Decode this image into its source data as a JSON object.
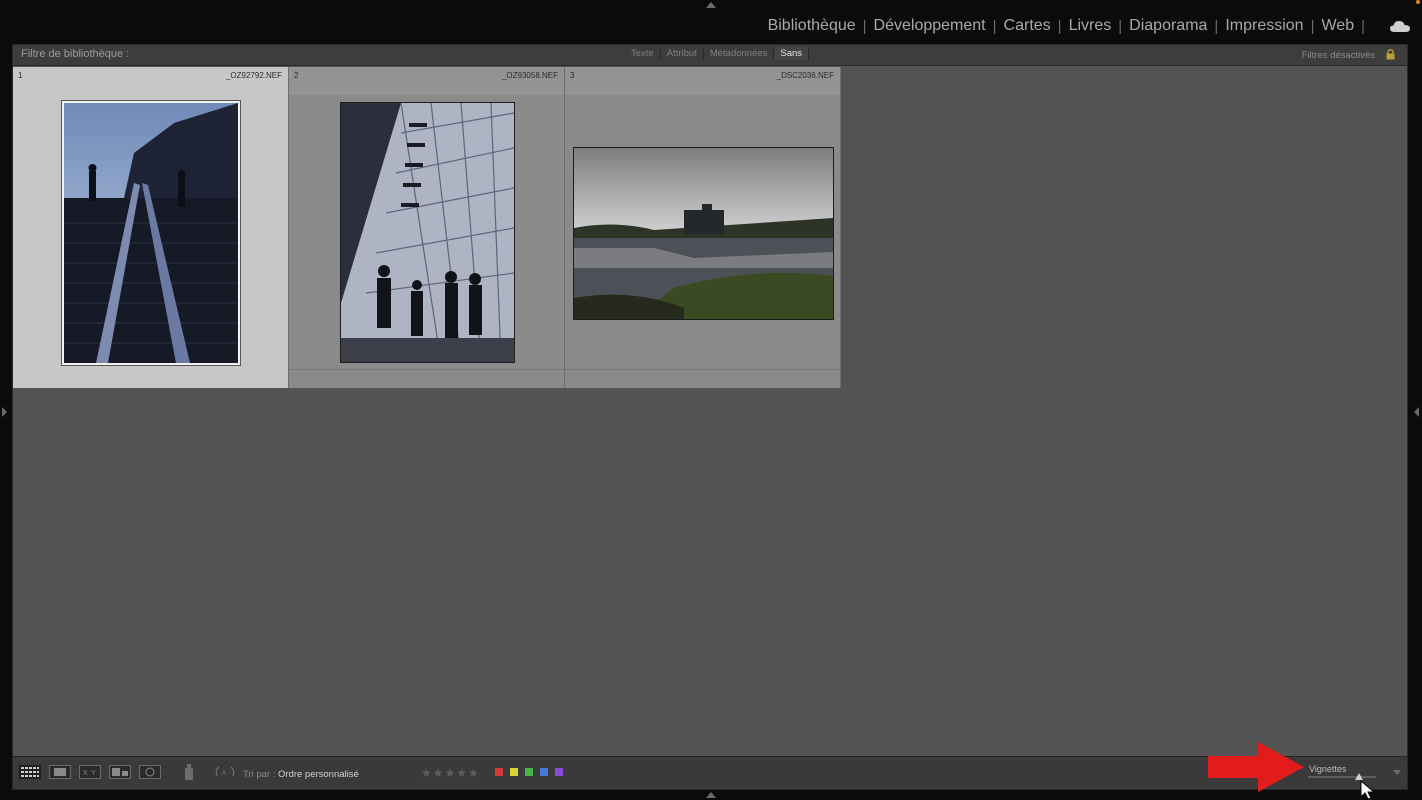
{
  "modules": [
    {
      "label": "Bibliothèque",
      "active": true
    },
    {
      "label": "Développement",
      "active": false
    },
    {
      "label": "Cartes",
      "active": false
    },
    {
      "label": "Livres",
      "active": false
    },
    {
      "label": "Diaporama",
      "active": false
    },
    {
      "label": "Impression",
      "active": false
    },
    {
      "label": "Web",
      "active": false
    }
  ],
  "filter_bar": {
    "title": "Filtre de bibliothèque :",
    "tabs": [
      {
        "label": "Texte",
        "active": false
      },
      {
        "label": "Attribut",
        "active": false
      },
      {
        "label": "Métadonnées",
        "active": false
      },
      {
        "label": "Sans",
        "active": true
      }
    ],
    "status": "Filtres désactivés"
  },
  "grid": {
    "photos": [
      {
        "index": "1",
        "filename": "_OZ92792.NEF",
        "selected": true,
        "orientation": "portrait"
      },
      {
        "index": "2",
        "filename": "_OZ93058.NEF",
        "selected": false,
        "orientation": "portrait"
      },
      {
        "index": "3",
        "filename": "_DSC2036.NEF",
        "selected": false,
        "orientation": "landscape"
      }
    ]
  },
  "toolbar": {
    "sort_label": "Tri par :",
    "sort_value": "Ordre personnalisé",
    "thumbnails_label": "Vignettes",
    "thumbnail_size": 0.7,
    "color_labels": [
      "#d43a3a",
      "#d6d63a",
      "#46b446",
      "#4a78d6",
      "#8a4ad6"
    ]
  },
  "icons": [
    "grid-view-icon",
    "loupe-view-icon",
    "compare-view-icon",
    "survey-view-icon",
    "people-view-icon",
    "spray-can-icon",
    "rotate-icon",
    "cloud-icon",
    "lock-icon"
  ],
  "colors": {
    "accent_orange": "#d9891b",
    "annotation_red": "#e31b1b",
    "selected_cell": "#c7c7c7"
  }
}
